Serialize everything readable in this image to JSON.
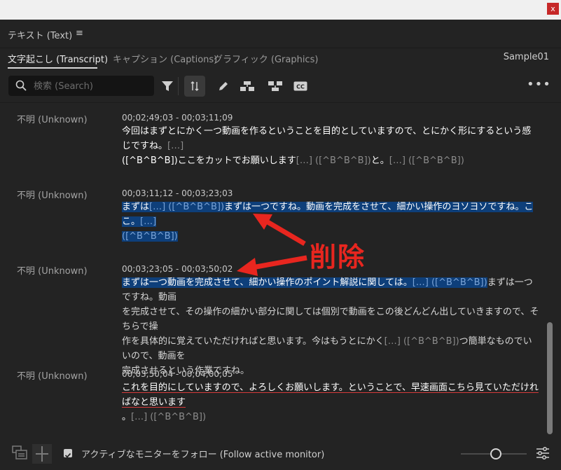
{
  "window": {
    "close_label": "x"
  },
  "panel": {
    "title": "テキスト (Text)",
    "menu_glyph": "≡"
  },
  "tabs": [
    {
      "label": "文字起こし (Transcript)",
      "active": true
    },
    {
      "label": "キャプション (Captions)",
      "active": false
    },
    {
      "label": "グラフィック (Graphics)",
      "active": false
    }
  ],
  "sequence_name": "Sample01",
  "search": {
    "placeholder": "検索 (Search)",
    "value": ""
  },
  "toolbar": {
    "icons": [
      "filter-icon",
      "pin-icon",
      "pencil-icon",
      "split-segment-icon",
      "merge-segment-icon",
      "cc-icon"
    ],
    "more_glyph": "•••"
  },
  "segments": [
    {
      "speaker": "不明 (Unknown)",
      "time": "00;02;49;03 - 00;03;11;09",
      "line1_a": "今回はまずとにかく一つ動画を作るということを目的としていますので、とにかく形にするという感じですね。",
      "line1_b": "[…]",
      "line2_a": "([^B^B^B])",
      "line2_b": "ここをカットでお願いします",
      "line2_c": "[…] ([^B^B^B])",
      "line2_d": "と。",
      "line2_e": "[…] ([^B^B^B])"
    },
    {
      "speaker": "不明 (Unknown)",
      "time": "00;03;11;12 - 00;03;23;03",
      "line1_a": "まずは",
      "line1_b": "[…] ([^B^B^B])",
      "line1_c": "まずは一つですね。動画を完成をさせて、細かい操作のヨソヨソですね。ここ。",
      "line1_d": "[…]",
      "line2_a": "([^B^B^B])"
    },
    {
      "speaker": "不明 (Unknown)",
      "time": "00;03;23;05 - 00;03;50;02",
      "line1_a": "まずは一つ動画を完成させて、細かい操作のポイント解説に関しては。",
      "line1_b": "[…] ([^B^B^B])",
      "line1_c": "まずは一つですね。動画",
      "line2": "を完成させて、その操作の細かい部分に関しては個別で動画をこの後どんどん出していきますので、そちらで操",
      "line3": "作を具体的に覚えていただければと思います。今はもうとにかく",
      "line3_b": "[…] ([^B^B^B])",
      "line3_c": "つ簡単なものでいいので、動画を",
      "line4": "完成させるという作業ですね。"
    },
    {
      "speaker": "不明 (Unknown)",
      "time": "00;03;50;04 - 00;04;00;05",
      "line1": "これを目的にしていますので、よろしくお願いします。ということで、早速画面こちら見ていただければなと思います",
      "line2_a": "。",
      "line2_b": "[…] ([^B^B^B])"
    }
  ],
  "annotation": {
    "label": "削除",
    "color": "#e8261f"
  },
  "footer": {
    "follow_monitor_label": "アクティブなモニターをフォロー (Follow active monitor)",
    "follow_monitor_checked": true
  },
  "colors": {
    "accent_highlight": "#0e3f7a",
    "annotation_red": "#e8261f",
    "background": "#232323"
  }
}
